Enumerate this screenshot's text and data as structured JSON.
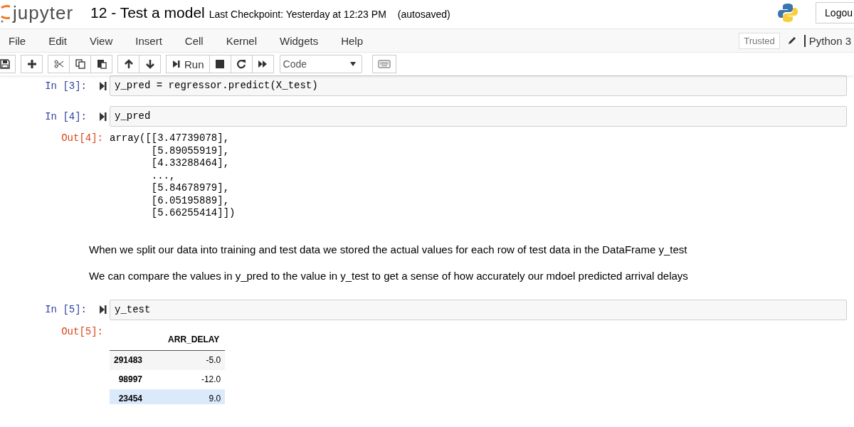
{
  "header": {
    "logo_text": "jupyter",
    "notebook_title": "12 - Test a model",
    "checkpoint": "Last Checkpoint: Yesterday at 12:23 PM",
    "autosave": "(autosaved)",
    "logout": "Logou"
  },
  "menu": [
    "File",
    "Edit",
    "View",
    "Insert",
    "Cell",
    "Kernel",
    "Widgets",
    "Help"
  ],
  "trusted": "Trusted",
  "kernel_name": "Python 3",
  "toolbar": {
    "run_label": "Run",
    "cell_type": "Code"
  },
  "cells": [
    {
      "kind": "code",
      "prompt": "In [3]:",
      "source": "y_pred = regressor.predict(X_test)"
    },
    {
      "kind": "code",
      "prompt": "In [4]:",
      "source": "y_pred",
      "output": {
        "kind": "text",
        "prompt": "Out[4]:",
        "lines": [
          "array([[3.47739078],",
          "       [5.89055919],",
          "       [4.33288464],",
          "       ...,",
          "       [5.84678979],",
          "       [6.05195889],",
          "       [5.66255414]])"
        ]
      }
    },
    {
      "kind": "markdown",
      "paragraphs": [
        "When we split our data into training and test data we stored the actual values for each row of test data in the DataFrame y_test",
        "We can compare the values in y_pred to the value in y_test to get a sense of how accurately our mdoel predicted arrival delays"
      ]
    },
    {
      "kind": "code",
      "prompt": "In [5]:",
      "source": "y_test",
      "output": {
        "kind": "table",
        "prompt": "Out[5]:",
        "columns": [
          "ARR_DELAY"
        ],
        "rows": [
          {
            "index": "291483",
            "values": [
              "-5.0"
            ],
            "hovered": false
          },
          {
            "index": "98997",
            "values": [
              "-12.0"
            ],
            "hovered": false
          },
          {
            "index": "23454",
            "values": [
              "9.0"
            ],
            "hovered": true
          }
        ]
      }
    }
  ]
}
